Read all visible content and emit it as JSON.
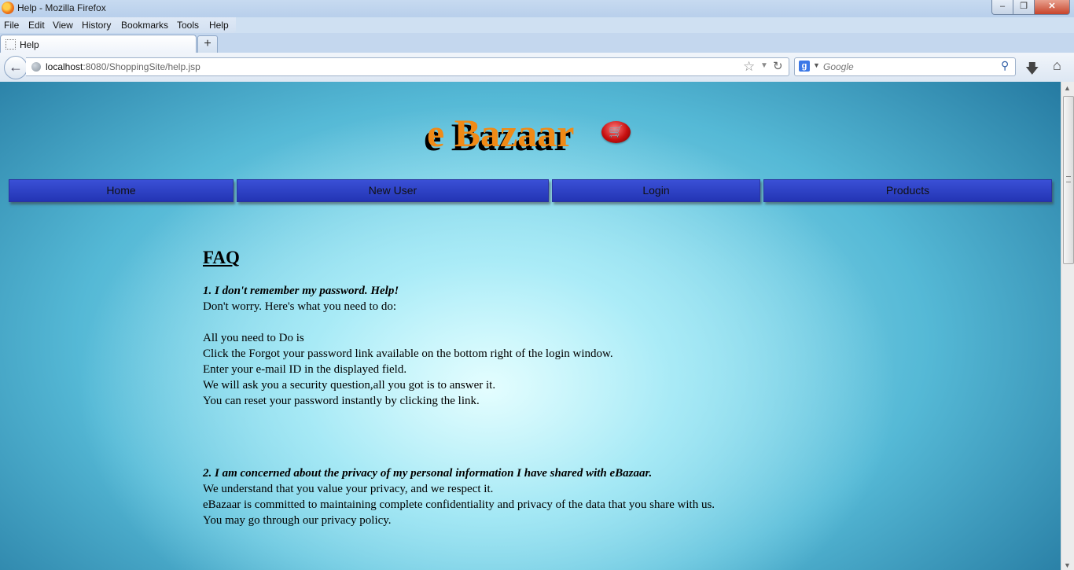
{
  "window": {
    "title": "Help - Mozilla Firefox",
    "min_label": "–",
    "max_label": "❒",
    "close_label": "✕"
  },
  "menu": [
    "File",
    "Edit",
    "View",
    "History",
    "Bookmarks",
    "Tools",
    "Help"
  ],
  "tab": {
    "label": "Help",
    "new_tab_label": "+"
  },
  "url": {
    "host": "localhost",
    "path": ":8080/ShoppingSite/help.jsp"
  },
  "search": {
    "engine_letter": "g",
    "placeholder": "Google"
  },
  "site": {
    "brand": "e Bazaar",
    "nav": [
      "Home",
      "New User",
      "Login",
      "Products"
    ]
  },
  "faq": {
    "title": "FAQ",
    "q1": "1. I don't remember my password. Help!",
    "q1_lines": [
      "Don't worry. Here's what you need to do:",
      "",
      "All you need to Do is",
      "Click the Forgot your password link available on the bottom right of the login window.",
      "Enter your e-mail ID in the displayed field.",
      "We will ask you a security question,all you got is to answer it.",
      "You can reset your password instantly by clicking the link."
    ],
    "q2": "2. I am concerned about the privacy of my personal information I have shared with eBazaar.",
    "q2_lines": [
      "We understand that you value your privacy, and we respect it.",
      "eBazaar is committed to maintaining complete confidentiality and privacy of the data that you share with us.",
      "You may go through our privacy policy."
    ]
  },
  "colors": {
    "brand": "#f08a16",
    "nav_bg": "#2c3fc6",
    "window_close": "#c7442b"
  }
}
